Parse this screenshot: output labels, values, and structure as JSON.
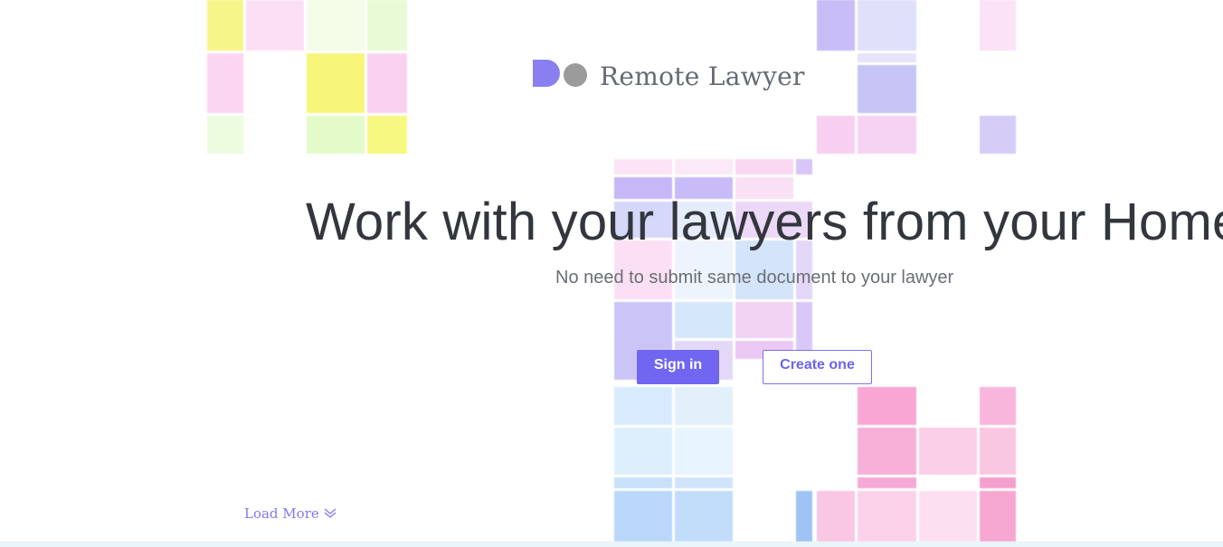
{
  "brand": {
    "name": "Remote Lawyer",
    "logo_icon": "do-logo-icon"
  },
  "hero": {
    "title": "Work with your lawyers from your Home",
    "subtitle": "No need to submit same document to your lawyer"
  },
  "actions": {
    "sign_in_label": "Sign in",
    "create_label": "Create one"
  },
  "footer": {
    "load_more_label": "Load More",
    "load_more_icon": "double-chevron-down-icon"
  },
  "colors": {
    "accent": "#7066f2",
    "title": "#33363c",
    "subtitle": "#6b6e75"
  }
}
